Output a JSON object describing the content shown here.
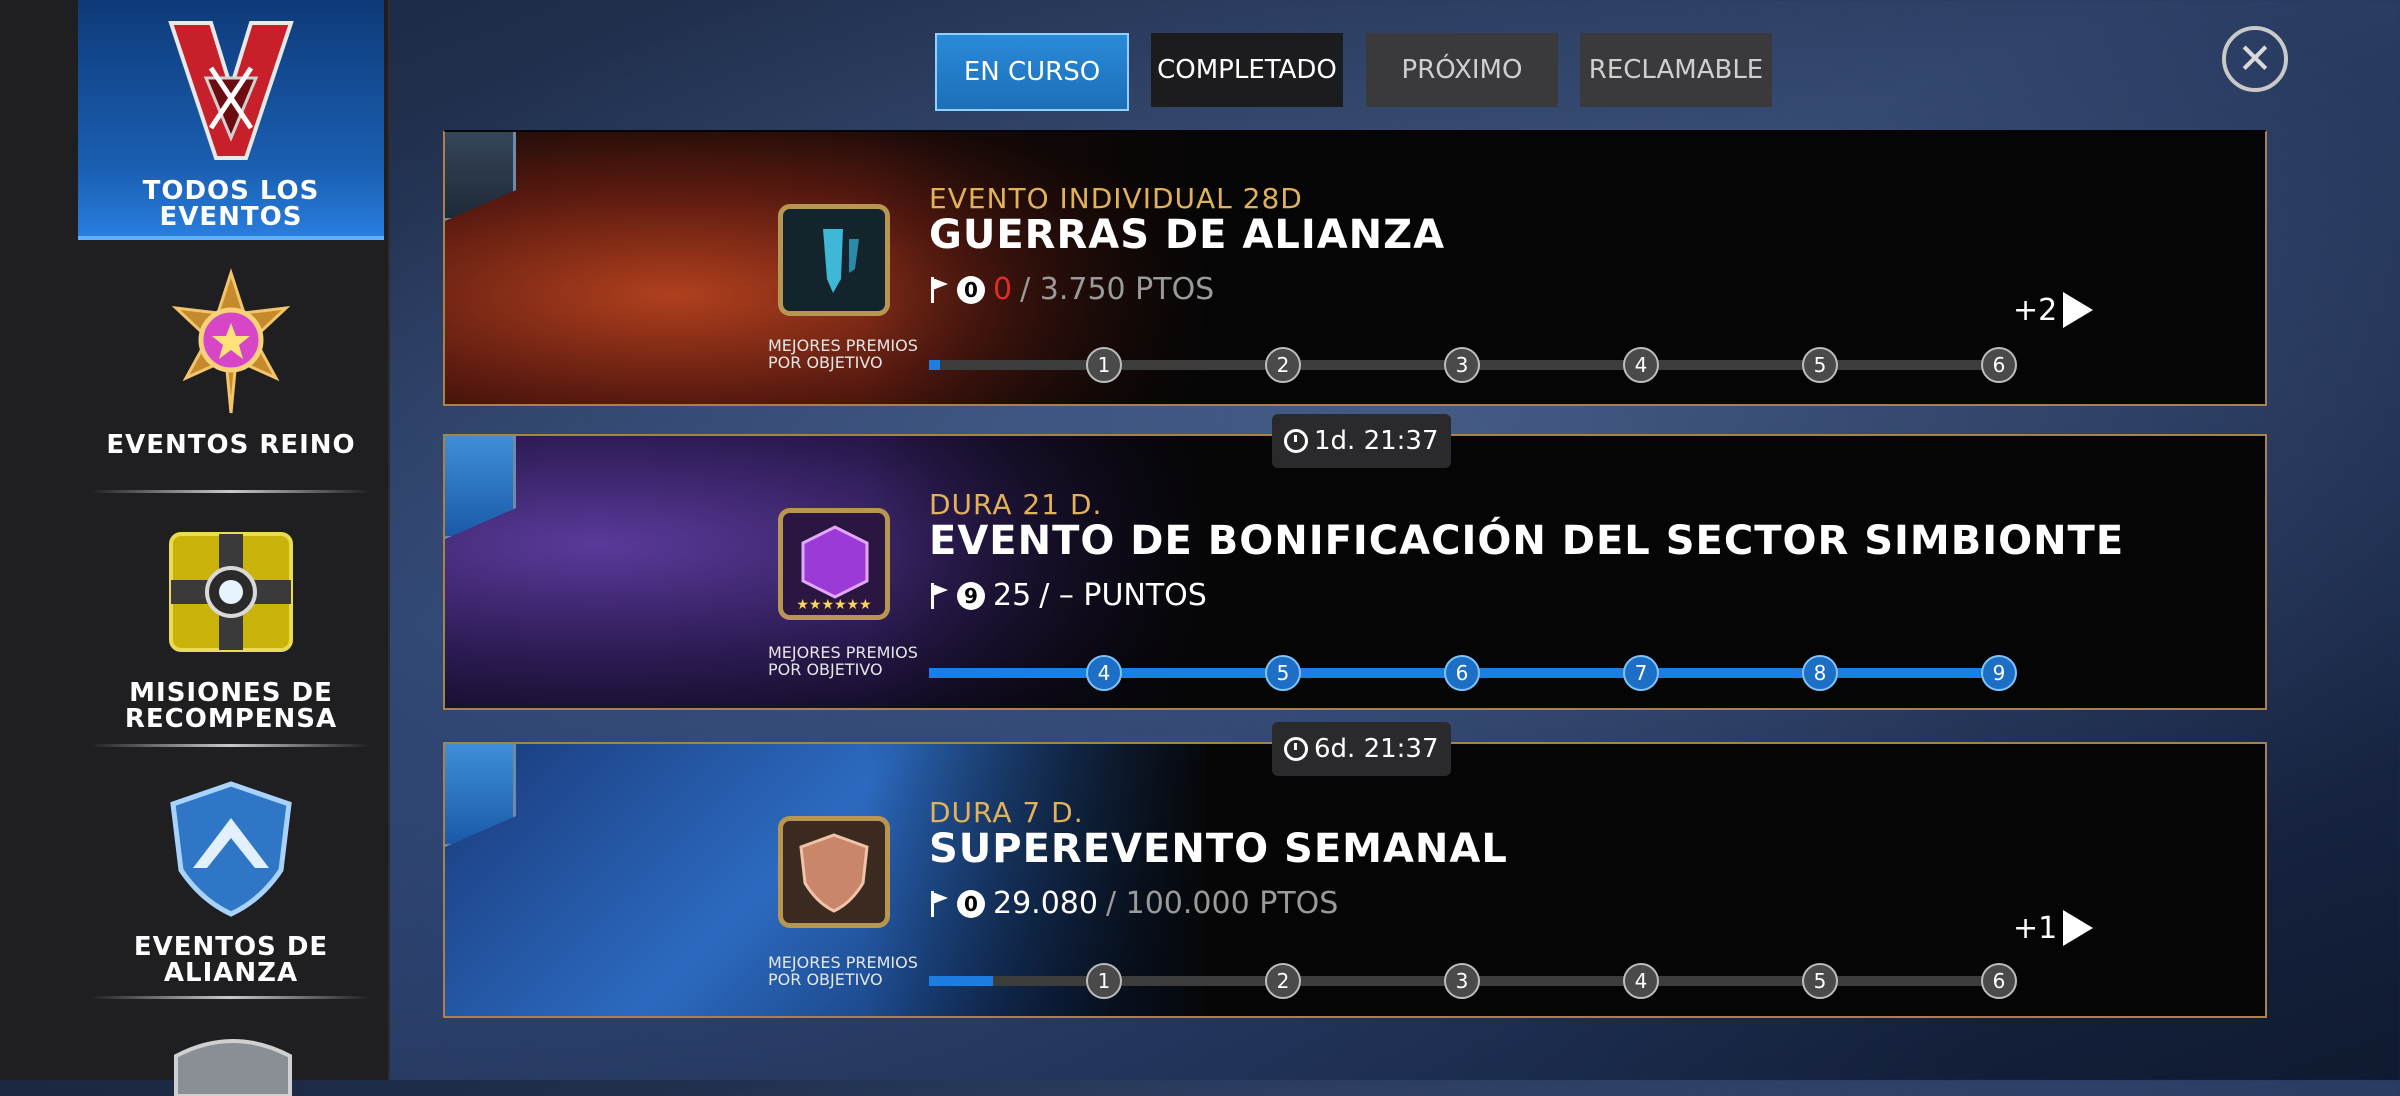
{
  "sidebar": {
    "items": [
      {
        "label": "TODOS LOS\nEVENTOS",
        "l1": "TODOS LOS",
        "l2": "EVENTOS",
        "icon": "v-crest-icon"
      },
      {
        "label": "EVENTOS REINO",
        "l1": "EVENTOS REINO",
        "icon": "star-medal-icon"
      },
      {
        "label": "MISIONES DE RECOMPENSA",
        "l1": "MISIONES DE",
        "l2": "RECOMPENSA",
        "icon": "reward-crate-icon"
      },
      {
        "label": "EVENTOS DE ALIANZA",
        "l1": "EVENTOS DE",
        "l2": "ALIANZA",
        "icon": "alliance-shield-icon"
      }
    ]
  },
  "tabs": [
    {
      "label": "EN CURSO",
      "state": "active"
    },
    {
      "label": "COMPLETADO"
    },
    {
      "label": "PRÓXIMO"
    },
    {
      "label": "RECLAMABLE"
    }
  ],
  "events": [
    {
      "subtitle": "EVENTO INDIVIDUAL 28D",
      "title": "GUERRAS DE ALIANZA",
      "score_current": "0",
      "score_rest": "/ 3.750 PTOS",
      "flag_value": "0",
      "reward_caption_1": "MEJORES PREMIOS",
      "reward_caption_2": "POR OBJETIVO",
      "more": "+2",
      "milestones": [
        "1",
        "2",
        "3",
        "4",
        "5",
        "6"
      ],
      "progress": 0.01
    },
    {
      "timer": "1d. 21:37",
      "subtitle": "DURA 21 D.",
      "title": "EVENTO DE BONIFICACIÓN DEL SECTOR SIMBIONTE",
      "score_current": "25",
      "score_rest": "/ – PUNTOS",
      "flag_value": "9",
      "reward_caption_1": "MEJORES PREMIOS",
      "reward_caption_2": "POR OBJETIVO",
      "milestones": [
        "4",
        "5",
        "6",
        "7",
        "8",
        "9"
      ],
      "progress": 1.0
    },
    {
      "timer": "6d. 21:37",
      "subtitle": "DURA 7 D.",
      "title": "SUPEREVENTO SEMANAL",
      "score_current": "29.080",
      "score_rest": "/ 100.000 PTOS",
      "flag_value": "0",
      "reward_caption_1": "MEJORES PREMIOS",
      "reward_caption_2": "POR OBJETIVO",
      "more": "+1",
      "milestones": [
        "1",
        "2",
        "3",
        "4",
        "5",
        "6"
      ],
      "progress": 0.06
    }
  ],
  "colors": {
    "accent": "#1c7ee0",
    "gold": "#e1b25a",
    "card_border": "#a8824a"
  }
}
